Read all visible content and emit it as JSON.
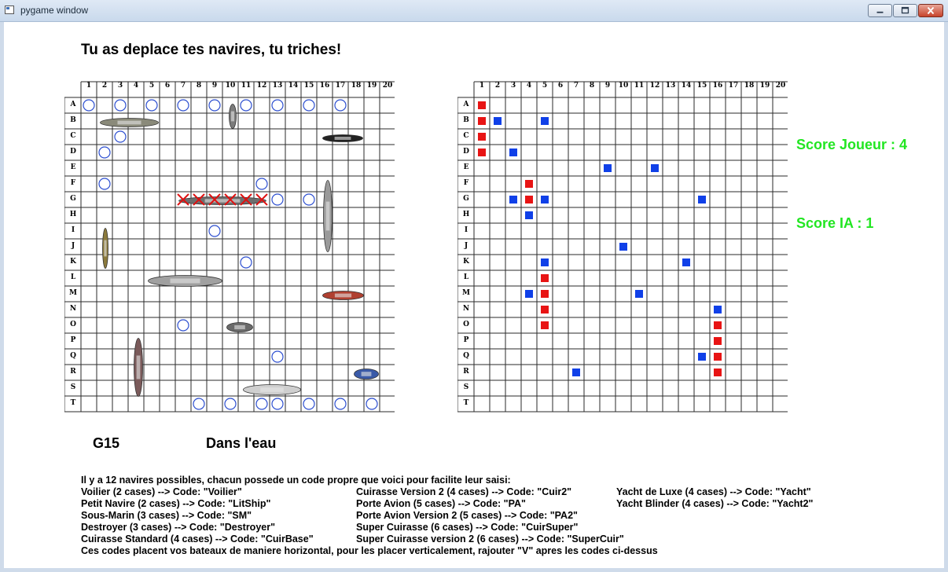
{
  "window": {
    "title": "pygame window"
  },
  "headline": "Tu as deplace tes navires, tu triches!",
  "columns": [
    "1",
    "2",
    "3",
    "4",
    "5",
    "6",
    "7",
    "8",
    "9",
    "10",
    "11",
    "12",
    "13",
    "14",
    "15",
    "16",
    "17",
    "18",
    "19",
    "20"
  ],
  "rows": [
    "A",
    "B",
    "C",
    "D",
    "E",
    "F",
    "G",
    "H",
    "I",
    "J",
    "K",
    "L",
    "M",
    "N",
    "O",
    "P",
    "Q",
    "R",
    "S",
    "T"
  ],
  "colors": {
    "score": "#22e622",
    "hit": "#e81414",
    "miss_ai": "#1040e8",
    "miss_player": "#2d4fd0",
    "cross": "#e01010"
  },
  "player_board": {
    "misses": [
      "A1",
      "A3",
      "A5",
      "A7",
      "A9",
      "A11",
      "A13",
      "A15",
      "A17",
      "C3",
      "D2",
      "F2",
      "F12",
      "G13",
      "G15",
      "I9",
      "K11",
      "O7",
      "Q13",
      "T8",
      "T10",
      "T12",
      "T13",
      "T15",
      "T17",
      "T19"
    ],
    "hits": [
      "G7",
      "G8",
      "G9",
      "G10",
      "G11",
      "G12"
    ],
    "ships": [
      {
        "name": "Cuirasse Standard",
        "icon": "battleship-icon",
        "cells": "B2-B5"
      },
      {
        "name": "Yacht",
        "icon": "yacht-icon",
        "cells": "B10"
      },
      {
        "name": "Sous-Marin",
        "icon": "submarine-icon",
        "cells": "C16-C18"
      },
      {
        "name": "Porte Avion Version 2",
        "icon": "aircraft-carrier-icon",
        "cells": "F16-J16"
      },
      {
        "name": "Super Cuirasse",
        "icon": "battleship-icon",
        "cells": "G7-G12"
      },
      {
        "name": "Petit Navire",
        "icon": "small-ship-icon",
        "cells": "I2-K2"
      },
      {
        "name": "Porte Avion",
        "icon": "aircraft-carrier-icon",
        "cells": "L5-L9"
      },
      {
        "name": "Yacht de Luxe",
        "icon": "cruise-ship-icon",
        "cells": "M16-M18"
      },
      {
        "name": "Voilier",
        "icon": "boat-icon",
        "cells": "O11-O12"
      },
      {
        "name": "Super Cuirasse version 2",
        "icon": "battleship-icon",
        "cells": "P4-S4"
      },
      {
        "name": "Yacht Blinder",
        "icon": "speedboat-icon",
        "cells": "R18-R19"
      },
      {
        "name": "Yacht",
        "icon": "yacht-icon",
        "cells": "S12-S15"
      }
    ]
  },
  "ai_board": {
    "hits": [
      "A1",
      "B1",
      "C1",
      "D1",
      "F4",
      "G4",
      "L5",
      "M5",
      "N5",
      "O5",
      "O16",
      "P16",
      "Q16",
      "R16"
    ],
    "misses": [
      "B2",
      "B5",
      "D3",
      "E9",
      "E12",
      "G3",
      "G5",
      "G15",
      "H4",
      "J10",
      "K5",
      "K14",
      "M4",
      "M11",
      "N16",
      "Q15",
      "R7"
    ]
  },
  "scores": {
    "player": "Score Joueur : 4",
    "ai": "Score IA : 1"
  },
  "last_shot": {
    "position": "G15",
    "result": "Dans l'eau"
  },
  "instructions": {
    "intro": "Il y a 12 navires possibles, chacun possede un code propre que voici pour facilite leur saisi:",
    "col1": [
      "Voilier (2 cases) --> Code: \"Voilier\"",
      "Petit Navire (2 cases) --> Code: \"LitShip\"",
      "Sous-Marin (3 cases) --> Code: \"SM\"",
      "Destroyer (3 cases) --> Code: \"Destroyer\"",
      "Cuirasse Standard (4 cases) --> Code: \"CuirBase\""
    ],
    "col2": [
      "Cuirasse Version 2 (4 cases) --> Code: \"Cuir2\"",
      "Porte Avion (5 cases) --> Code: \"PA\"",
      "Porte Avion Version 2 (5 cases) --> Code: \"PA2\"",
      "Super Cuirasse (6 cases) --> Code: \"CuirSuper\"",
      "Super Cuirasse version 2 (6 cases) --> Code: \"SuperCuir\""
    ],
    "col3": [
      "Yacht de Luxe (4 cases) --> Code: \"Yacht\"",
      "Yacht Blinder (4 cases) --> Code: \"Yacht2\""
    ],
    "footer": "Ces codes placent vos bateaux de maniere horizontal, pour les placer verticalement, rajouter \"V\" apres les codes ci-dessus"
  }
}
